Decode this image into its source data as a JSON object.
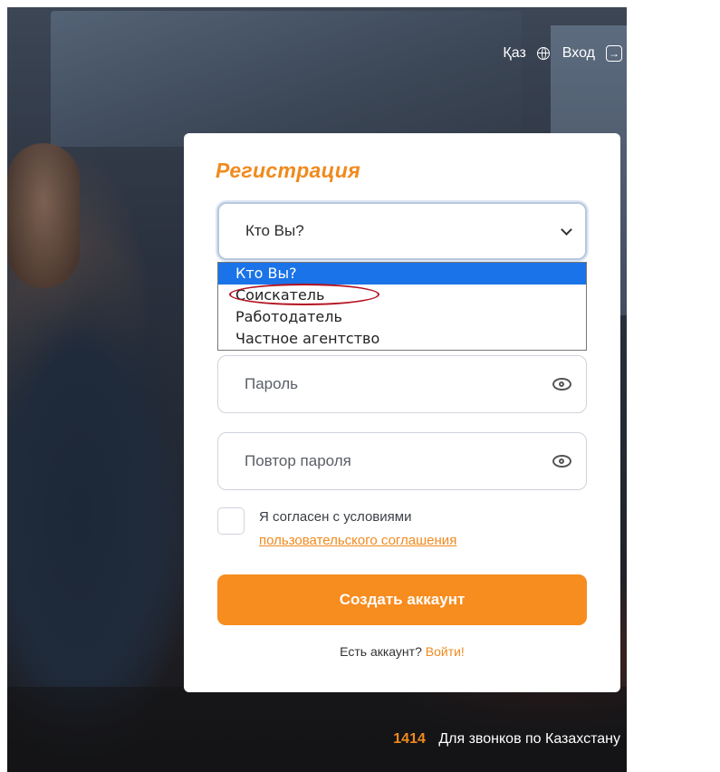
{
  "topnav": {
    "lang_label": "Қаз",
    "login_label": "Вход",
    "lang_icon": "globe-icon",
    "login_icon": "login-arrow-icon"
  },
  "form": {
    "title": "Регистрация",
    "role_select": {
      "value": "Кто Вы?",
      "options": [
        "Кто Вы?",
        "Соискатель",
        "Работодатель",
        "Частное агентство"
      ],
      "highlighted_option": "Соискатель"
    },
    "password_placeholder": "Пароль",
    "password_repeat_placeholder": "Повтор пароля",
    "agree_text": "Я согласен с условиями",
    "agree_link": "пользовательского соглашения",
    "submit_label": "Создать аккаунт",
    "have_account_text": "Есть аккаунт?",
    "login_link": "Войти!"
  },
  "footer": {
    "hotline_number": "1414",
    "hotline_text": "Для звонков по Казахстану"
  },
  "colors": {
    "accent": "#f78c1f",
    "title": "#f08a1e",
    "selected_option": "#1a73e8",
    "annotation_circle": "#b3121f"
  }
}
